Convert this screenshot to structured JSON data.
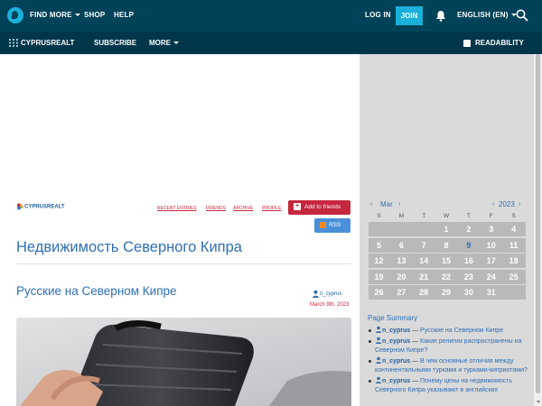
{
  "topbar": {
    "find_more": "FIND MORE",
    "shop": "SHOP",
    "help": "HELP",
    "login": "LOG IN",
    "join": "JOIN",
    "language": "ENGLISH (EN)"
  },
  "subbar": {
    "journal": "CYPRUSREALT",
    "subscribe": "SUBSCRIBE",
    "more": "MORE",
    "readability": "READABILITY"
  },
  "journal": {
    "username": "CYPRUSREALT",
    "links": [
      "RECENT ENTRIES",
      "FRIENDS",
      "ARCHIVE",
      "PROFILE"
    ],
    "add_friends": "Add to friends",
    "rss": "RSS",
    "title": "Недвижимость Северного Кипра"
  },
  "post": {
    "title": "Русские на Северном Кипре",
    "author": "n_cyprus",
    "date": "March 9th, 2023"
  },
  "calendar": {
    "month": "Mar",
    "year": "2023",
    "prev": "‹",
    "next": "›",
    "weekdays": [
      "S",
      "M",
      "T",
      "W",
      "T",
      "F",
      "S"
    ],
    "weeks": [
      [
        "",
        "",
        "",
        "1",
        "2",
        "3",
        "4"
      ],
      [
        "5",
        "6",
        "7",
        "8",
        "9",
        "10",
        "11"
      ],
      [
        "12",
        "13",
        "14",
        "15",
        "16",
        "17",
        "18"
      ],
      [
        "19",
        "20",
        "21",
        "22",
        "23",
        "24",
        "25"
      ],
      [
        "26",
        "27",
        "28",
        "29",
        "30",
        "31",
        ""
      ]
    ],
    "highlighted_day": "9"
  },
  "page_summary": {
    "title": "Page Summary",
    "items": [
      {
        "author": "n_cyprus",
        "dash": "—",
        "text": "Русские на Северном Кипре"
      },
      {
        "author": "n_cyprus",
        "dash": "—",
        "text": "Какие религии распространены на Северном Кипре?"
      },
      {
        "author": "n_cyprus",
        "dash": "—",
        "text": "В чем основные отличия между континентальными турками и турками-киприотами?"
      },
      {
        "author": "n_cyprus",
        "dash": "—",
        "text": "Почему цены на недвижимость Северного Кипра указывают в английских"
      }
    ]
  },
  "colors": {
    "topbar": "#004359",
    "subbar": "#00364a",
    "accent": "#1ab0d9",
    "link": "#2f6fb5",
    "red": "#c5283d",
    "sidebar": "#dadada"
  }
}
